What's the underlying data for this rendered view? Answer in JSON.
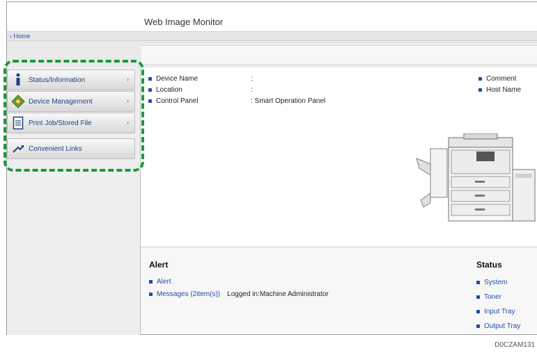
{
  "app": {
    "title": "Web Image Monitor"
  },
  "breadcrumb": {
    "home": "Home"
  },
  "menu": {
    "items": [
      {
        "label": "Status/Information",
        "arrow": "›",
        "icon": "info-icon"
      },
      {
        "label": "Device Management",
        "arrow": "›",
        "icon": "device-management-icon"
      },
      {
        "label": "Print Job/Stored File",
        "arrow": "›",
        "icon": "document-icon"
      }
    ],
    "links": {
      "label": "Convenient Links",
      "icon": "link-arrow-icon"
    }
  },
  "device_info": {
    "rows": [
      {
        "key": "Device Name",
        "value": ":"
      },
      {
        "key": "Location",
        "value": ":"
      },
      {
        "key": "Control Panel",
        "value": ": Smart Operation Panel"
      }
    ],
    "right": [
      "Comment",
      "Host Name"
    ]
  },
  "alert": {
    "title": "Alert",
    "items": [
      "Alert",
      "Messages (2item(s))"
    ],
    "logged_in": "Logged in:Machine Administrator"
  },
  "status": {
    "title": "Status",
    "items": [
      "System",
      "Toner",
      "Input Tray",
      "Output Tray"
    ]
  },
  "figure_code": "D0CZAM131",
  "colors": {
    "highlight": "#179b3b",
    "link": "#1f4ea8",
    "sidebar": "#eeeeee"
  }
}
